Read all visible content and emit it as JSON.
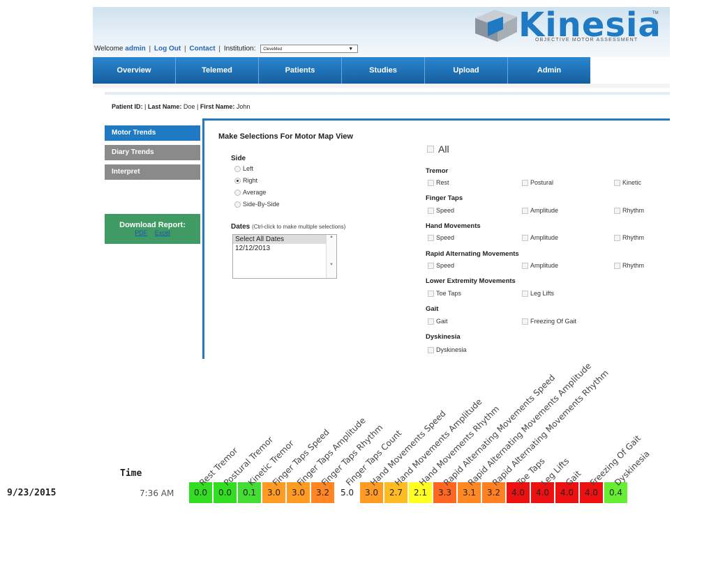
{
  "header": {
    "welcome_prefix": "Welcome",
    "user": "admin",
    "logout": "Log Out",
    "contact": "Contact",
    "institution_label": "Institution:",
    "institution_value": "CleveMed",
    "logo_text": "Kinesia",
    "logo_tagline": "OBJECTIVE MOTOR ASSESSMENT",
    "logo_tm": "TM"
  },
  "nav": {
    "tabs": [
      "Overview",
      "Telemed",
      "Patients",
      "Studies",
      "Upload",
      "Admin"
    ]
  },
  "patient": {
    "id_label": "Patient ID:",
    "last_name_label": "Last Name:",
    "last_name": "Doe",
    "first_name_label": "First Name:",
    "first_name": "John"
  },
  "sidebar": {
    "items": [
      "Motor Trends",
      "Diary Trends",
      "Interpret"
    ],
    "download_title": "Download Report:",
    "download_links": [
      "PDF",
      "Excel"
    ]
  },
  "form": {
    "title": "Make Selections For Motor Map View",
    "side_label": "Side",
    "side_options": [
      "Left",
      "Right",
      "Average",
      "Side-By-Side"
    ],
    "side_selected": "Right",
    "dates_label": "Dates",
    "dates_hint": "(Ctrl-click to make multiple selections)",
    "dates_options": [
      "Select All Dates",
      "12/12/2013"
    ],
    "all_label": "All",
    "groups": [
      {
        "name": "Tremor",
        "items": [
          "Rest",
          "Postural",
          "Kinetic"
        ]
      },
      {
        "name": "Finger Taps",
        "items": [
          "Speed",
          "Amplitude",
          "Rhythm"
        ]
      },
      {
        "name": "Hand Movements",
        "items": [
          "Speed",
          "Amplitude",
          "Rhythm"
        ]
      },
      {
        "name": "Rapid Alternating Movements",
        "items": [
          "Speed",
          "Amplitude",
          "Rhythm"
        ]
      },
      {
        "name": "Lower Extremity Movements",
        "items": [
          "Toe Taps",
          "Leg Lifts"
        ]
      },
      {
        "name": "Gait",
        "items": [
          "Gait",
          "Freezing Of Gait"
        ]
      },
      {
        "name": "Dyskinesia",
        "items": [
          "Dyskinesia"
        ]
      }
    ]
  },
  "heatmap": {
    "date": "9/23/2015",
    "time_header": "Time",
    "time": "7:36 AM",
    "columns": [
      {
        "label": "Rest Tremor",
        "value": "0.0",
        "color": "#33dd22"
      },
      {
        "label": "Postural Tremor",
        "value": "0.0",
        "color": "#33dd22"
      },
      {
        "label": "Kinetic Tremor",
        "value": "0.1",
        "color": "#44dd33"
      },
      {
        "label": "Finger Taps Speed",
        "value": "3.0",
        "color": "#ff9a22"
      },
      {
        "label": "Finger Taps Amplitude",
        "value": "3.0",
        "color": "#ff9a22"
      },
      {
        "label": "Finger Taps Rhythm",
        "value": "3.2",
        "color": "#ff8622"
      },
      {
        "label": "Finger Taps Count",
        "value": "5.0",
        "color": "#ffffff"
      },
      {
        "label": "Hand Movements Speed",
        "value": "3.0",
        "color": "#ff9a22"
      },
      {
        "label": "Hand Movements Amplitude",
        "value": "2.7",
        "color": "#ffbb22"
      },
      {
        "label": "Hand Movements Rhythm",
        "value": "2.1",
        "color": "#ffff22"
      },
      {
        "label": "Rapid Alternating Movements Speed",
        "value": "3.3",
        "color": "#ff6622"
      },
      {
        "label": "Rapid Alternating Movements Amplitude",
        "value": "3.1",
        "color": "#ff8822"
      },
      {
        "label": "Rapid Alternating Movements Rhythm",
        "value": "3.2",
        "color": "#ff8022"
      },
      {
        "label": "Toe Taps",
        "value": "4.0",
        "color": "#ee1111"
      },
      {
        "label": "Leg Lifts",
        "value": "4.0",
        "color": "#ee1111"
      },
      {
        "label": "Gait",
        "value": "4.0",
        "color": "#ee1111"
      },
      {
        "label": "Freezing Of Gait",
        "value": "4.0",
        "color": "#ee1111"
      },
      {
        "label": "Dyskinesia",
        "value": "0.4",
        "color": "#66ee33"
      }
    ]
  }
}
